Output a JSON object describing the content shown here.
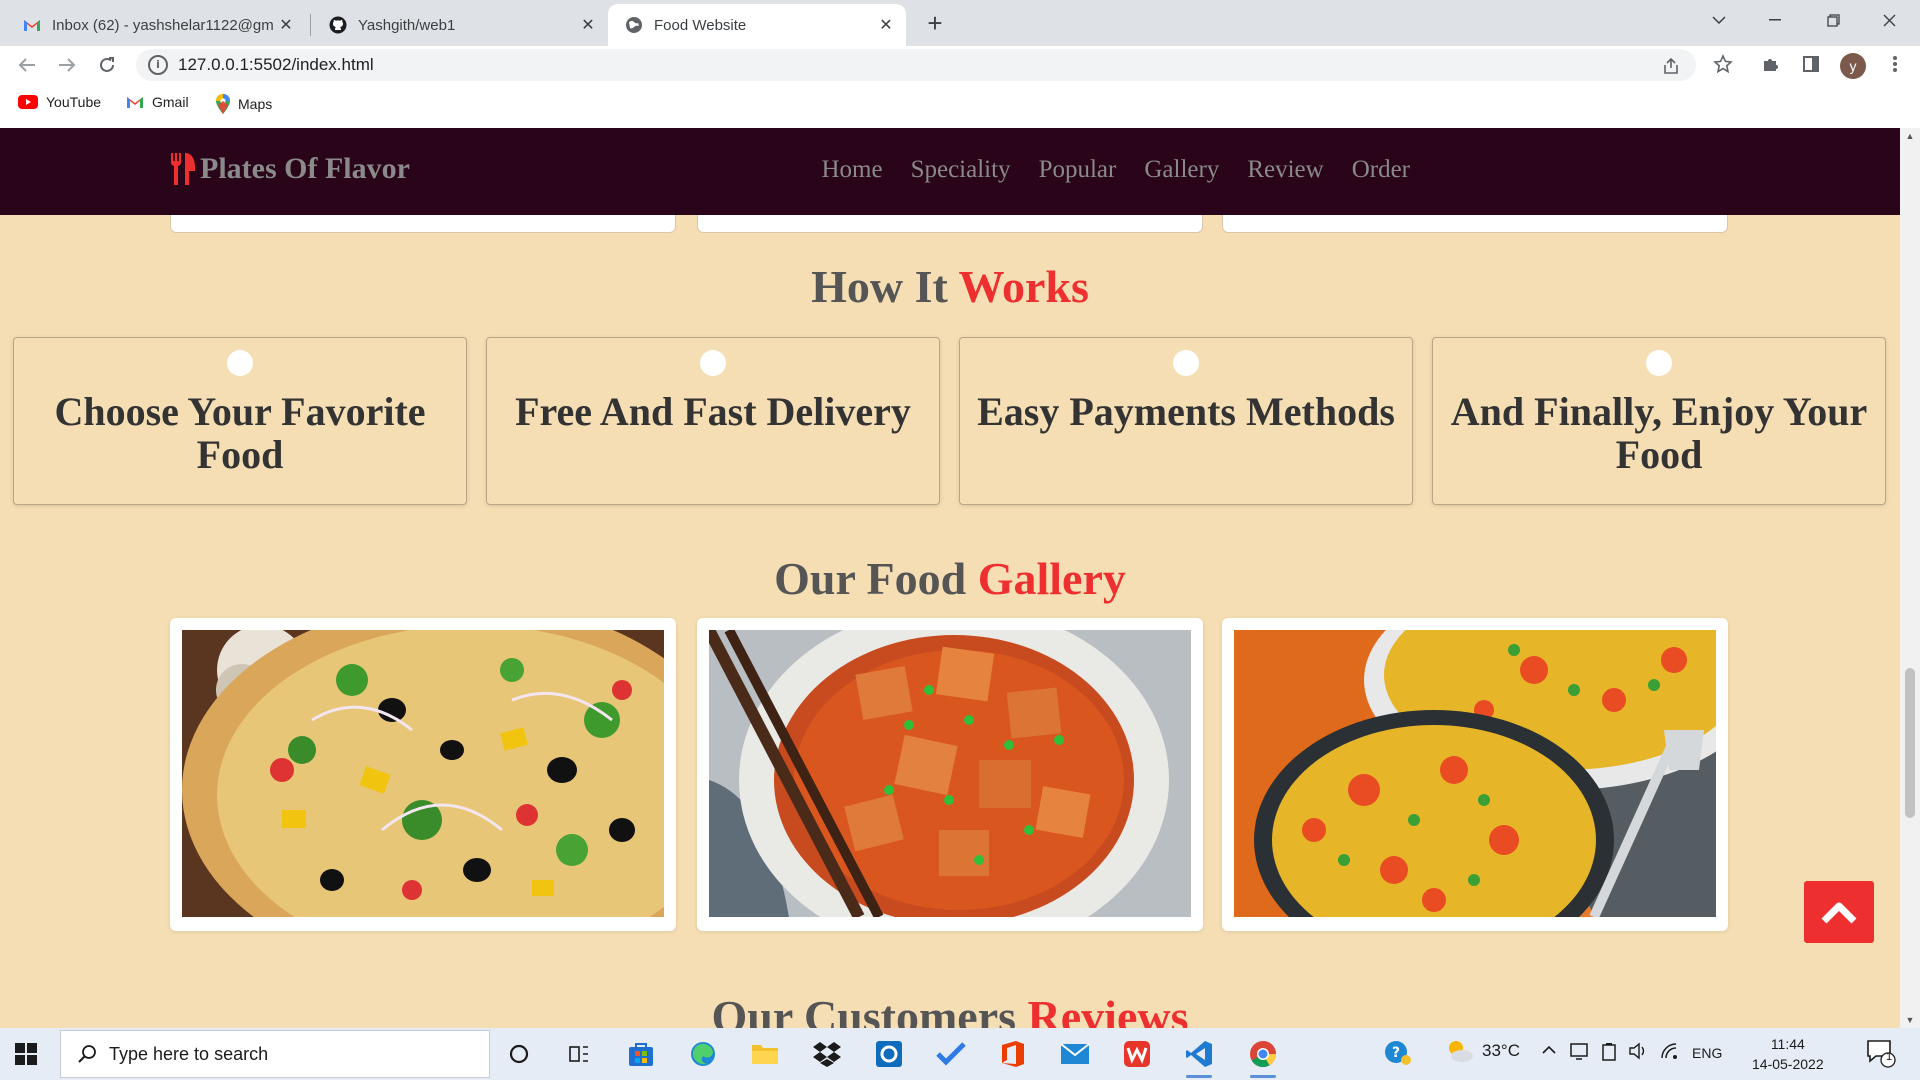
{
  "browser": {
    "tabs": [
      {
        "title": "Inbox (62) - yashshelar1122@gm",
        "icon": "gmail-icon"
      },
      {
        "title": "Yashgith/web1",
        "icon": "github-icon"
      },
      {
        "title": "Food Website",
        "icon": "globe-icon",
        "active": true
      }
    ],
    "url": "127.0.0.1:5502/index.html",
    "profile_initial": "y",
    "bookmarks": [
      {
        "label": "YouTube",
        "icon": "youtube-icon"
      },
      {
        "label": "Gmail",
        "icon": "gmail-icon"
      },
      {
        "label": "Maps",
        "icon": "maps-icon"
      }
    ]
  },
  "site": {
    "logo_text": "Plates Of Flavor",
    "nav": [
      "Home",
      "Speciality",
      "Popular",
      "Gallery",
      "Review",
      "Order"
    ],
    "how_it_works": {
      "title_main": "How It ",
      "title_accent": "Works",
      "steps": [
        "Choose Your Favorite Food",
        "Free And Fast Delivery",
        "Easy Payments Methods",
        "And Finally, Enjoy Your Food"
      ]
    },
    "gallery": {
      "title_main": "Our Food ",
      "title_accent": "Gallery",
      "images": [
        "pizza",
        "mapo tofu",
        "vegetable rice"
      ]
    },
    "reviews": {
      "title_main": "Our Customers ",
      "title_accent": "Reviews"
    },
    "accent_color": "#ed2f30",
    "header_color": "#2a0418",
    "background_color": "#f5deb3"
  },
  "taskbar": {
    "search_placeholder": "Type here to search",
    "weather": "33°C",
    "language": "ENG",
    "time": "11:44",
    "date": "14-05-2022",
    "notification_count": "1"
  }
}
